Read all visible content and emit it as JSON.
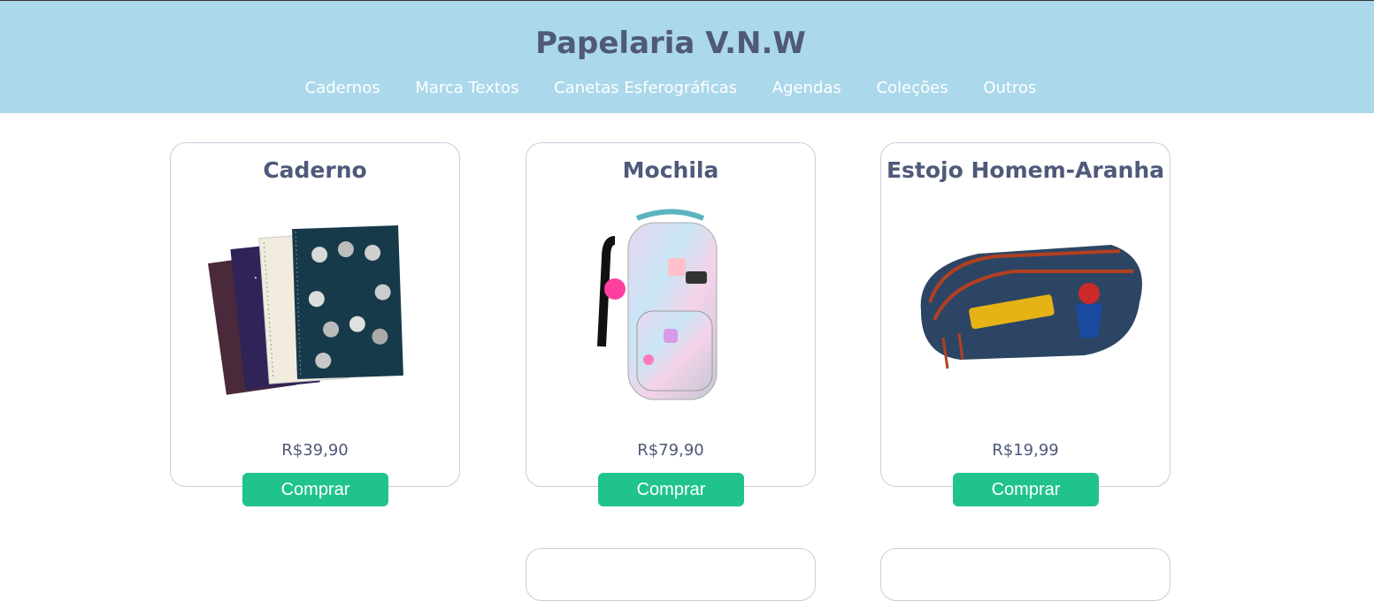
{
  "header": {
    "title": "Papelaria V.N.W",
    "nav": [
      "Cadernos",
      "Marca Textos",
      "Canetas Esferográficas",
      "Agendas",
      "Coleções",
      "Outros"
    ]
  },
  "products": [
    {
      "name": "Caderno",
      "price": "R$39,90",
      "button": "Comprar",
      "image_icon": "notebooks-image"
    },
    {
      "name": "Mochila",
      "price": "R$79,90",
      "button": "Comprar",
      "image_icon": "backpack-image"
    },
    {
      "name": "Estojo Homem-Aranha",
      "price": "R$19,99",
      "button": "Comprar",
      "image_icon": "pencil-case-image"
    }
  ],
  "colors": {
    "header_bg": "#abd8ea",
    "title": "#4f5979",
    "button": "#20c38e"
  }
}
